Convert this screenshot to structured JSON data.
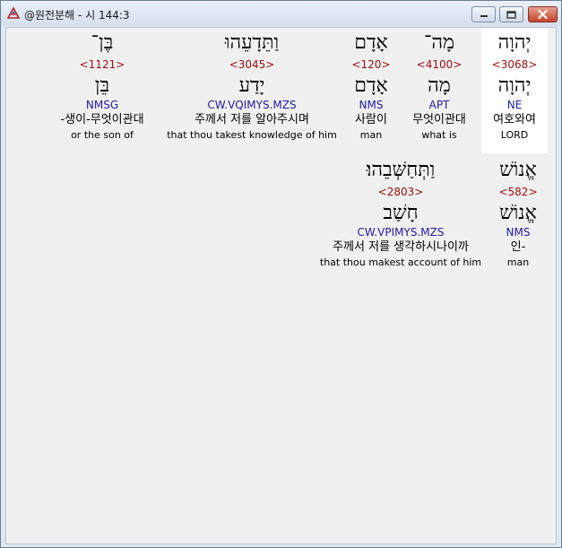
{
  "window": {
    "title": "@원전분해 - 시 144:3"
  },
  "words": [
    {
      "hebrew": "יְהוָה",
      "strongs": "<3068>",
      "lemma": "יְהוָה",
      "morph": "NE",
      "korean": "여호와여",
      "english": "LORD",
      "highlighted": true
    },
    {
      "hebrew": "מָה־",
      "strongs": "<4100>",
      "lemma": "מָה",
      "morph": "APT",
      "korean": "무엇이관대",
      "english": "what is",
      "highlighted": false
    },
    {
      "hebrew": "אָדָם",
      "strongs": "<120>",
      "lemma": "אָדָם",
      "morph": "NMS",
      "korean": "사람이",
      "english": "man",
      "highlighted": false
    },
    {
      "hebrew": "וַתֵּדָעֵהוּ",
      "strongs": "<3045>",
      "lemma": "יָדַע",
      "morph": "CW.VQIMYS.MZS",
      "korean": "주께서 저를 알아주시며",
      "english": "that thou takest knowledge of him",
      "highlighted": false
    },
    {
      "hebrew": "בֶּן־",
      "strongs": "<1121>",
      "lemma": "בֵּן",
      "morph": "NMSG",
      "korean": "-생이-무엇이관대",
      "english": "or the son of",
      "highlighted": false
    },
    {
      "hebrew": "אֱנוֹשׁ",
      "strongs": "<582>",
      "lemma": "אֱנוֹשׁ",
      "morph": "NMS",
      "korean": "인-",
      "english": "man",
      "highlighted": false
    },
    {
      "hebrew": "וַתְּחַשְּׁבֵהוּ׃",
      "strongs": "<2803>",
      "lemma": "חָשַׁב",
      "morph": "CW.VPIMYS.MZS",
      "korean": "주께서 저를 생각하시나이까",
      "english": "that thou makest account of him",
      "highlighted": false
    }
  ]
}
